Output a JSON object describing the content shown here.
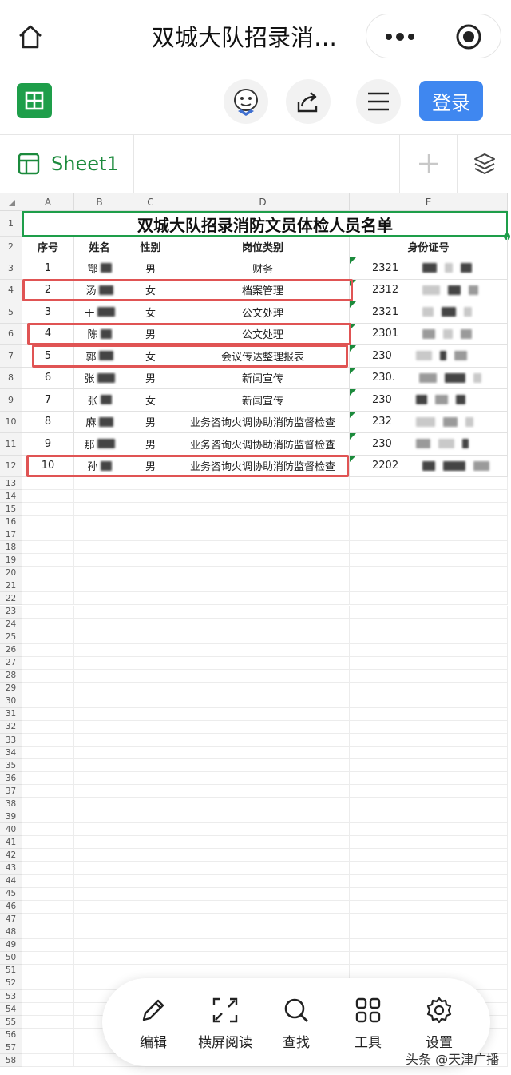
{
  "nav": {
    "title": "双城大队招录消…",
    "icons": [
      "home-icon",
      "more-icon",
      "close-icon"
    ]
  },
  "toolbar": {
    "login_label": "登录",
    "icons": [
      "sheets-logo-icon",
      "mascot-avatar-icon",
      "share-icon",
      "menu-icon"
    ],
    "accent_color": "#3f87f0"
  },
  "tabs": {
    "sheet_name": "Sheet1",
    "icons": [
      "sheet-icon",
      "add-sheet-icon",
      "layers-icon"
    ]
  },
  "grid": {
    "columns": [
      "A",
      "B",
      "C",
      "D",
      "E"
    ],
    "title": "双城大队招录消防文员体检人员名单",
    "headers": [
      "序号",
      "姓名",
      "性别",
      "岗位类别",
      "身份证号"
    ],
    "rows": [
      {
        "no": "1",
        "name": "鄂",
        "gender": "男",
        "post": "财务",
        "id": "2321",
        "rownum": "3"
      },
      {
        "no": "2",
        "name": "汤",
        "gender": "女",
        "post": "档案管理",
        "id": "2312",
        "rownum": "4"
      },
      {
        "no": "3",
        "name": "于",
        "gender": "女",
        "post": "公文处理",
        "id": "2321",
        "rownum": "5"
      },
      {
        "no": "4",
        "name": "陈",
        "gender": "男",
        "post": "公文处理",
        "id": "2301",
        "rownum": "6"
      },
      {
        "no": "5",
        "name": "郭",
        "gender": "女",
        "post": "会议传达整理报表",
        "id": "230",
        "rownum": "7"
      },
      {
        "no": "6",
        "name": "张",
        "gender": "男",
        "post": "新闻宣传",
        "id": "230.",
        "rownum": "8"
      },
      {
        "no": "7",
        "name": "张",
        "gender": "女",
        "post": "新闻宣传",
        "id": "230",
        "rownum": "9"
      },
      {
        "no": "8",
        "name": "麻",
        "gender": "男",
        "post": "业务咨询火调协助消防监督检查",
        "id": "232",
        "rownum": "10"
      },
      {
        "no": "9",
        "name": "那",
        "gender": "男",
        "post": "业务咨询火调协助消防监督检查",
        "id": "230",
        "rownum": "11"
      },
      {
        "no": "10",
        "name": "孙",
        "gender": "男",
        "post": "业务咨询火调协助消防监督检查",
        "id": "2202",
        "rownum": "12"
      }
    ],
    "highlighted_rows": [
      "4",
      "6",
      "7",
      "12"
    ],
    "highlight_color": "#e05454",
    "selection_color": "#1e9e4a",
    "extra_row_numbers": [
      "13",
      "14",
      "15",
      "16",
      "17",
      "18",
      "19",
      "20",
      "21",
      "22",
      "23",
      "24",
      "25",
      "26",
      "27",
      "28",
      "29",
      "30",
      "31",
      "32",
      "33",
      "34",
      "35",
      "36",
      "37",
      "38",
      "39",
      "40",
      "41",
      "42",
      "43",
      "44",
      "45",
      "46",
      "47",
      "48",
      "49",
      "50",
      "51",
      "52",
      "53",
      "54",
      "55",
      "56",
      "57",
      "58"
    ]
  },
  "bottom_menu": {
    "items": [
      {
        "label": "编辑",
        "icon": "edit-pencil-icon"
      },
      {
        "label": "横屏阅读",
        "icon": "landscape-expand-icon"
      },
      {
        "label": "查找",
        "icon": "search-icon"
      },
      {
        "label": "工具",
        "icon": "tools-grid-icon"
      },
      {
        "label": "设置",
        "icon": "settings-gear-icon"
      }
    ]
  },
  "watermark": "头条 @天津广播"
}
